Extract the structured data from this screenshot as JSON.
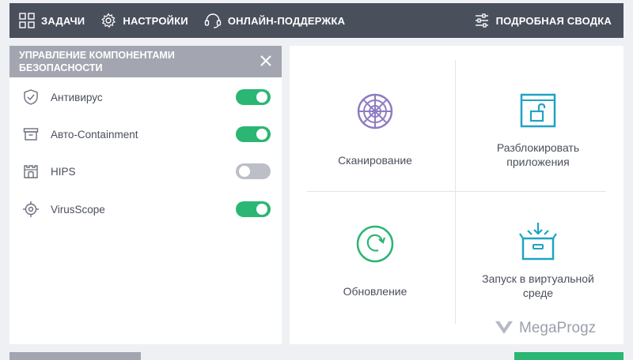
{
  "topbar": {
    "tasks_label": "ЗАДАЧИ",
    "settings_label": "НАСТРОЙКИ",
    "support_label": "ОНЛАЙН-ПОДДЕРЖКА",
    "summary_label": "ПОДРОБНАЯ СВОДКА"
  },
  "components_panel": {
    "title": "УПРАВЛЕНИЕ КОМПОНЕНТАМИ БЕЗОПАСНОСТИ",
    "items": [
      {
        "label": "Антивирус",
        "icon": "shield-icon",
        "enabled": true
      },
      {
        "label": "Авто-Containment",
        "icon": "archive-box-icon",
        "enabled": true
      },
      {
        "label": "HIPS",
        "icon": "castle-icon",
        "enabled": false
      },
      {
        "label": "VirusScope",
        "icon": "crosshair-icon",
        "enabled": true
      }
    ]
  },
  "actions": {
    "scan_label": "Сканирование",
    "unblock_label": "Разблокировать приложения",
    "update_label": "Обновление",
    "virtual_label": "Запуск в виртуальной среде"
  },
  "watermark": {
    "text": "MegaProgz"
  },
  "colors": {
    "topbar_bg": "#4a4f5c",
    "panel_header_bg": "#a3a6b0",
    "toggle_on": "#2bb673",
    "toggle_off": "#bcbfc7",
    "scan_icon": "#8e7cc3",
    "unblock_icon": "#1fa3c4",
    "update_icon": "#2bb673",
    "virtual_icon": "#1fa3c4"
  }
}
